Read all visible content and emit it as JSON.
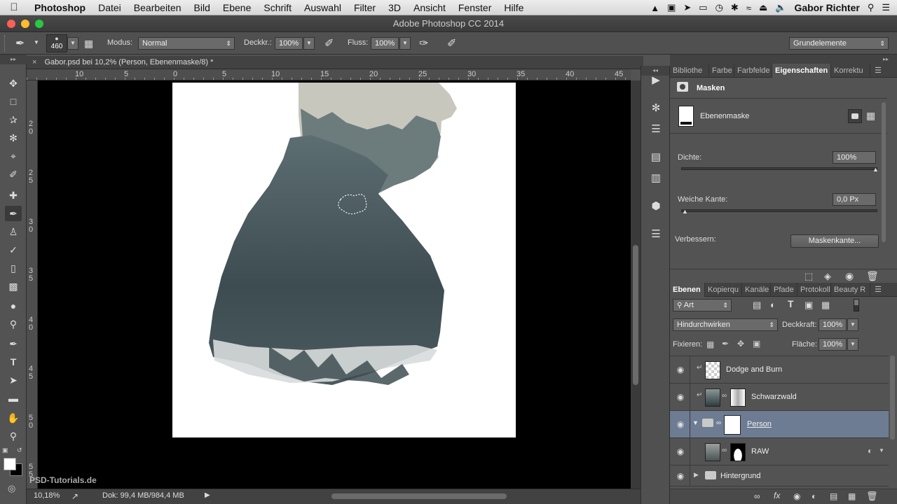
{
  "menubar": {
    "app": "Photoshop",
    "items": [
      "Datei",
      "Bearbeiten",
      "Bild",
      "Ebene",
      "Schrift",
      "Auswahl",
      "Filter",
      "3D",
      "Ansicht",
      "Fenster",
      "Hilfe"
    ],
    "user": "Gabor Richter"
  },
  "window": {
    "title": "Adobe Photoshop CC 2014"
  },
  "options": {
    "brush_size": "460",
    "mode_label": "Modus:",
    "mode_value": "Normal",
    "opacity_label": "Deckkr.:",
    "opacity_value": "100%",
    "flow_label": "Fluss:",
    "flow_value": "100%",
    "workspace": "Grundelemente"
  },
  "document": {
    "tab_title": "Gabor.psd bei 10,2% (Person, Ebenenmaske/8) *",
    "ruler_top": [
      "10",
      "5",
      "0",
      "5",
      "10",
      "15",
      "20",
      "25",
      "30",
      "35",
      "40",
      "45"
    ],
    "ruler_left": [
      "2\n0",
      "2\n5",
      "3\n0",
      "3\n5",
      "4\n0",
      "4\n5",
      "5\n0",
      "5\n5"
    ],
    "zoom": "10,18%",
    "doc_info": "Dok: 99,4 MB/984,4 MB",
    "watermark": "PSD-Tutorials.de"
  },
  "properties": {
    "tabs": [
      "Bibliothe",
      "Farbe",
      "Farbfelde",
      "Eigenschaften",
      "Korrektu"
    ],
    "active_tab": "Eigenschaften",
    "section": "Masken",
    "mask_label": "Ebenenmaske",
    "density_label": "Dichte:",
    "density_value": "100%",
    "density_fraction": 1.0,
    "feather_label": "Weiche Kante:",
    "feather_value": "0,0 Px",
    "feather_fraction": 0.0,
    "refine_label": "Verbessern:",
    "refine_button": "Maskenkante..."
  },
  "layers_panel": {
    "tabs": [
      "Ebenen",
      "Kopierqu",
      "Kanäle",
      "Pfade",
      "Protokoll",
      "Beauty R"
    ],
    "active_tab": "Ebenen",
    "filter_kind": "Art",
    "blend_mode": "Hindurchwirken",
    "opacity_label": "Deckkraft:",
    "opacity_value": "100%",
    "lock_label": "Fixieren:",
    "fill_label": "Fläche:",
    "fill_value": "100%",
    "layers": [
      {
        "name": "Dodge and Burn",
        "selected": false
      },
      {
        "name": "Schwarzwald",
        "selected": false
      },
      {
        "name": "Person",
        "selected": true
      },
      {
        "name": "RAW",
        "selected": false
      },
      {
        "name": "Hintergrund",
        "selected": false
      }
    ]
  },
  "colors": {
    "selected_layer": "#6d7c93",
    "panel_bg": "#535353",
    "canvas_bg": "#000000"
  }
}
